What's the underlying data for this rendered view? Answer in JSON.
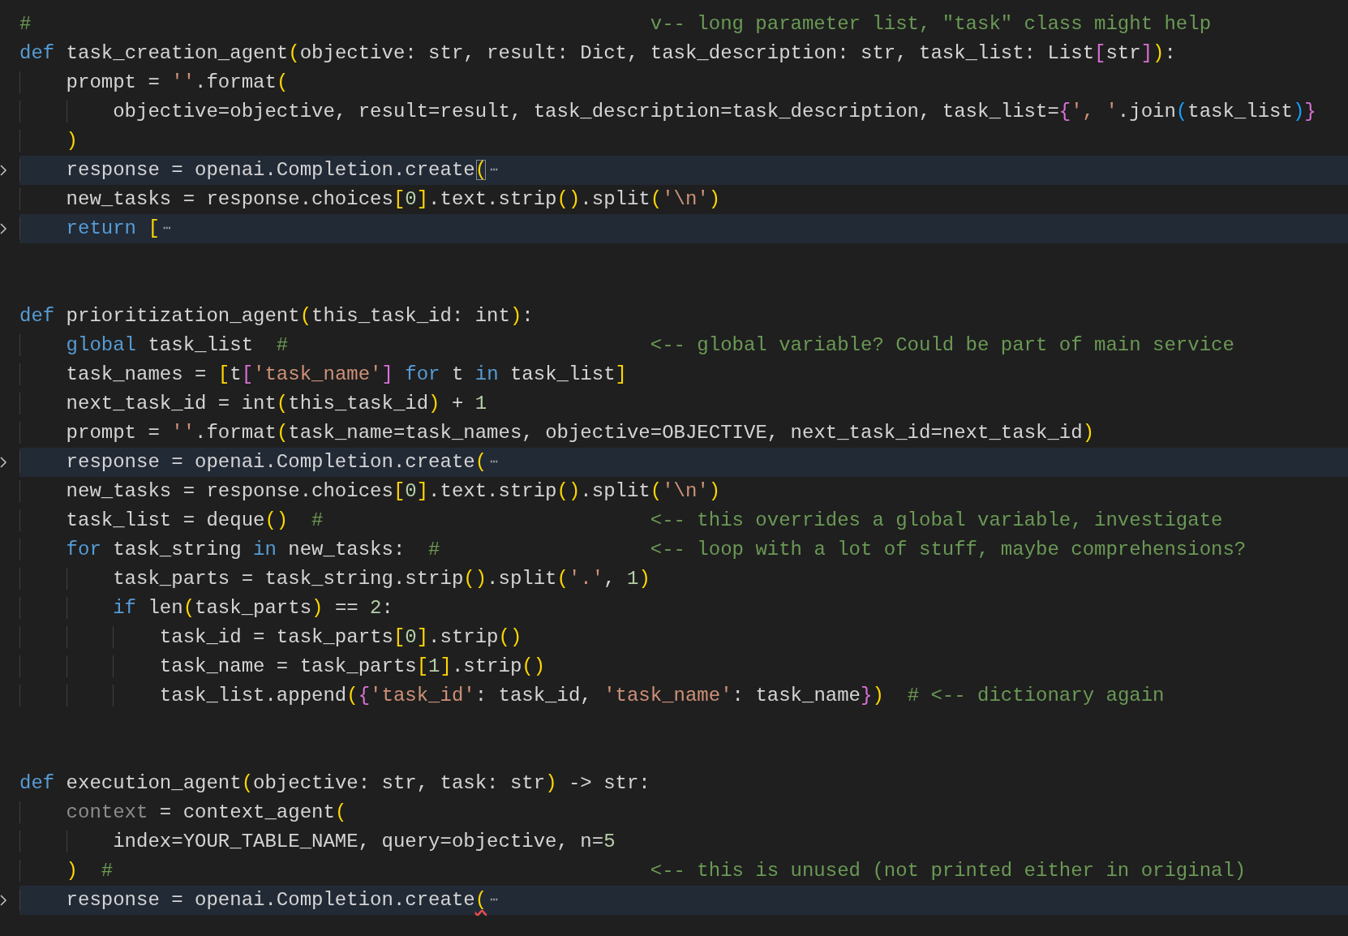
{
  "editor": {
    "lines": [
      {
        "folded": false,
        "tokens": [
          {
            "text": "#                                                     v-- long parameter list, \"task\" class might help",
            "kind": "comment"
          }
        ]
      },
      {
        "folded": false,
        "tokens": [
          {
            "text": "def",
            "kind": "keyword"
          },
          {
            "text": " task_creation_agent",
            "kind": "plain"
          },
          {
            "text": "(",
            "kind": "bracket1"
          },
          {
            "text": "objective: str, result: Dict, task_description: str, task_list: List",
            "kind": "plain"
          },
          {
            "text": "[",
            "kind": "bracket2"
          },
          {
            "text": "str",
            "kind": "plain"
          },
          {
            "text": "]",
            "kind": "bracket2"
          },
          {
            "text": ")",
            "kind": "bracket1"
          },
          {
            "text": ":",
            "kind": "plain"
          }
        ]
      },
      {
        "folded": false,
        "tokens": [
          {
            "text": "    prompt = ",
            "kind": "plain"
          },
          {
            "text": "''",
            "kind": "string"
          },
          {
            "text": ".format",
            "kind": "plain"
          },
          {
            "text": "(",
            "kind": "bracket1"
          }
        ]
      },
      {
        "folded": false,
        "tokens": [
          {
            "text": "        objective=objective, result=result, task_description=task_description, task_list=",
            "kind": "plain"
          },
          {
            "text": "{",
            "kind": "bracket2"
          },
          {
            "text": "', '",
            "kind": "string"
          },
          {
            "text": ".join",
            "kind": "plain"
          },
          {
            "text": "(",
            "kind": "bracket3"
          },
          {
            "text": "task_list",
            "kind": "plain"
          },
          {
            "text": ")",
            "kind": "bracket3"
          },
          {
            "text": "}",
            "kind": "bracket2"
          }
        ]
      },
      {
        "folded": false,
        "tokens": [
          {
            "text": "    )",
            "kind": "bracket1"
          }
        ]
      },
      {
        "folded": true,
        "ellipsis": "⋯",
        "tokens": [
          {
            "text": "    response = openai.Completion.create",
            "kind": "plain"
          },
          {
            "text": "(",
            "kind": "bracket1-matched"
          }
        ]
      },
      {
        "folded": false,
        "tokens": [
          {
            "text": "    new_tasks = response.choices",
            "kind": "plain"
          },
          {
            "text": "[",
            "kind": "bracket1"
          },
          {
            "text": "0",
            "kind": "number"
          },
          {
            "text": "]",
            "kind": "bracket1"
          },
          {
            "text": ".text.strip",
            "kind": "plain"
          },
          {
            "text": "()",
            "kind": "bracket1"
          },
          {
            "text": ".split",
            "kind": "plain"
          },
          {
            "text": "(",
            "kind": "bracket1"
          },
          {
            "text": "'\\n'",
            "kind": "string"
          },
          {
            "text": ")",
            "kind": "bracket1"
          }
        ]
      },
      {
        "folded": true,
        "ellipsis": "⋯",
        "tokens": [
          {
            "text": "    return ",
            "kind": "keyword"
          },
          {
            "text": "[",
            "kind": "bracket1"
          }
        ]
      },
      {
        "folded": false
      },
      {
        "folded": false
      },
      {
        "folded": false,
        "tokens": [
          {
            "text": "def",
            "kind": "keyword"
          },
          {
            "text": " prioritization_agent",
            "kind": "plain"
          },
          {
            "text": "(",
            "kind": "bracket1"
          },
          {
            "text": "this_task_id: int",
            "kind": "plain"
          },
          {
            "text": ")",
            "kind": "bracket1"
          },
          {
            "text": ":",
            "kind": "plain"
          }
        ]
      },
      {
        "folded": false,
        "tokens": [
          {
            "text": "    global",
            "kind": "keyword"
          },
          {
            "text": " task_list  ",
            "kind": "plain"
          },
          {
            "text": "#                               <-- global variable? Could be part of main service",
            "kind": "comment"
          }
        ]
      },
      {
        "folded": false,
        "tokens": [
          {
            "text": "    task_names = ",
            "kind": "plain"
          },
          {
            "text": "[",
            "kind": "bracket1"
          },
          {
            "text": "t",
            "kind": "plain"
          },
          {
            "text": "[",
            "kind": "bracket2"
          },
          {
            "text": "'task_name'",
            "kind": "string"
          },
          {
            "text": "]",
            "kind": "bracket2"
          },
          {
            "text": " for",
            "kind": "keyword"
          },
          {
            "text": " t ",
            "kind": "plain"
          },
          {
            "text": "in",
            "kind": "keyword"
          },
          {
            "text": " task_list",
            "kind": "plain"
          },
          {
            "text": "]",
            "kind": "bracket1"
          }
        ]
      },
      {
        "folded": false,
        "tokens": [
          {
            "text": "    next_task_id = int",
            "kind": "plain"
          },
          {
            "text": "(",
            "kind": "bracket1"
          },
          {
            "text": "this_task_id",
            "kind": "plain"
          },
          {
            "text": ")",
            "kind": "bracket1"
          },
          {
            "text": " + ",
            "kind": "plain"
          },
          {
            "text": "1",
            "kind": "number"
          }
        ]
      },
      {
        "folded": false,
        "tokens": [
          {
            "text": "    prompt = ",
            "kind": "plain"
          },
          {
            "text": "''",
            "kind": "string"
          },
          {
            "text": ".format",
            "kind": "plain"
          },
          {
            "text": "(",
            "kind": "bracket1"
          },
          {
            "text": "task_name=task_names, objective=OBJECTIVE, next_task_id=next_task_id",
            "kind": "plain"
          },
          {
            "text": ")",
            "kind": "bracket1"
          }
        ]
      },
      {
        "folded": true,
        "ellipsis": "⋯",
        "tokens": [
          {
            "text": "    response = openai.Completion.create",
            "kind": "plain"
          },
          {
            "text": "(",
            "kind": "bracket1"
          }
        ]
      },
      {
        "folded": false,
        "tokens": [
          {
            "text": "    new_tasks = response.choices",
            "kind": "plain"
          },
          {
            "text": "[",
            "kind": "bracket1"
          },
          {
            "text": "0",
            "kind": "number"
          },
          {
            "text": "]",
            "kind": "bracket1"
          },
          {
            "text": ".text.strip",
            "kind": "plain"
          },
          {
            "text": "()",
            "kind": "bracket1"
          },
          {
            "text": ".split",
            "kind": "plain"
          },
          {
            "text": "(",
            "kind": "bracket1"
          },
          {
            "text": "'\\n'",
            "kind": "string"
          },
          {
            "text": ")",
            "kind": "bracket1"
          }
        ]
      },
      {
        "folded": false,
        "tokens": [
          {
            "text": "    task_list = deque",
            "kind": "plain"
          },
          {
            "text": "()",
            "kind": "bracket1"
          },
          {
            "text": "  #                            <-- this overrides a global variable, investigate",
            "kind": "comment"
          }
        ]
      },
      {
        "folded": false,
        "tokens": [
          {
            "text": "    for",
            "kind": "keyword"
          },
          {
            "text": " task_string ",
            "kind": "plain"
          },
          {
            "text": "in",
            "kind": "keyword"
          },
          {
            "text": " new_tasks:  ",
            "kind": "plain"
          },
          {
            "text": "#                  <-- loop with a lot of stuff, maybe comprehensions?",
            "kind": "comment"
          }
        ]
      },
      {
        "folded": false,
        "tokens": [
          {
            "text": "        task_parts = task_string.strip",
            "kind": "plain"
          },
          {
            "text": "()",
            "kind": "bracket1"
          },
          {
            "text": ".split",
            "kind": "plain"
          },
          {
            "text": "(",
            "kind": "bracket1"
          },
          {
            "text": "'.'",
            "kind": "string"
          },
          {
            "text": ", ",
            "kind": "plain"
          },
          {
            "text": "1",
            "kind": "number"
          },
          {
            "text": ")",
            "kind": "bracket1"
          }
        ]
      },
      {
        "folded": false,
        "tokens": [
          {
            "text": "        if",
            "kind": "keyword"
          },
          {
            "text": " len",
            "kind": "plain"
          },
          {
            "text": "(",
            "kind": "bracket1"
          },
          {
            "text": "task_parts",
            "kind": "plain"
          },
          {
            "text": ")",
            "kind": "bracket1"
          },
          {
            "text": " == ",
            "kind": "plain"
          },
          {
            "text": "2",
            "kind": "number"
          },
          {
            "text": ":",
            "kind": "plain"
          }
        ]
      },
      {
        "folded": false,
        "tokens": [
          {
            "text": "            task_id = task_parts",
            "kind": "plain"
          },
          {
            "text": "[",
            "kind": "bracket1"
          },
          {
            "text": "0",
            "kind": "number"
          },
          {
            "text": "]",
            "kind": "bracket1"
          },
          {
            "text": ".strip",
            "kind": "plain"
          },
          {
            "text": "()",
            "kind": "bracket1"
          }
        ]
      },
      {
        "folded": false,
        "tokens": [
          {
            "text": "            task_name = task_parts",
            "kind": "plain"
          },
          {
            "text": "[",
            "kind": "bracket1"
          },
          {
            "text": "1",
            "kind": "number"
          },
          {
            "text": "]",
            "kind": "bracket1"
          },
          {
            "text": ".strip",
            "kind": "plain"
          },
          {
            "text": "()",
            "kind": "bracket1"
          }
        ]
      },
      {
        "folded": false,
        "tokens": [
          {
            "text": "            task_list.append",
            "kind": "plain"
          },
          {
            "text": "(",
            "kind": "bracket1"
          },
          {
            "text": "{",
            "kind": "bracket2"
          },
          {
            "text": "'task_id'",
            "kind": "string"
          },
          {
            "text": ": task_id, ",
            "kind": "plain"
          },
          {
            "text": "'task_name'",
            "kind": "string"
          },
          {
            "text": ": task_name",
            "kind": "plain"
          },
          {
            "text": "}",
            "kind": "bracket2"
          },
          {
            "text": ")",
            "kind": "bracket1"
          },
          {
            "text": "  # <-- dictionary again",
            "kind": "comment"
          }
        ]
      },
      {
        "folded": false
      },
      {
        "folded": false
      },
      {
        "folded": false,
        "tokens": [
          {
            "text": "def",
            "kind": "keyword"
          },
          {
            "text": " execution_agent",
            "kind": "plain"
          },
          {
            "text": "(",
            "kind": "bracket1"
          },
          {
            "text": "objective: str, task: str",
            "kind": "plain"
          },
          {
            "text": ")",
            "kind": "bracket1"
          },
          {
            "text": " -> str:",
            "kind": "plain"
          }
        ]
      },
      {
        "folded": false,
        "tokens": [
          {
            "text": "    context",
            "kind": "unused"
          },
          {
            "text": " = context_agent",
            "kind": "plain"
          },
          {
            "text": "(",
            "kind": "bracket1"
          }
        ]
      },
      {
        "folded": false,
        "tokens": [
          {
            "text": "        index=YOUR_TABLE_NAME, query=objective, n=",
            "kind": "plain"
          },
          {
            "text": "5",
            "kind": "number"
          }
        ]
      },
      {
        "folded": false,
        "tokens": [
          {
            "text": "    )",
            "kind": "bracket1"
          },
          {
            "text": "  #                                              <-- this is unused (not printed either in original)",
            "kind": "comment"
          }
        ]
      },
      {
        "folded": true,
        "ellipsis": "⋯",
        "tokens": [
          {
            "text": "    response = openai.Completion.create",
            "kind": "plain"
          },
          {
            "text": "(",
            "kind": "bracket1-error"
          }
        ]
      }
    ]
  }
}
